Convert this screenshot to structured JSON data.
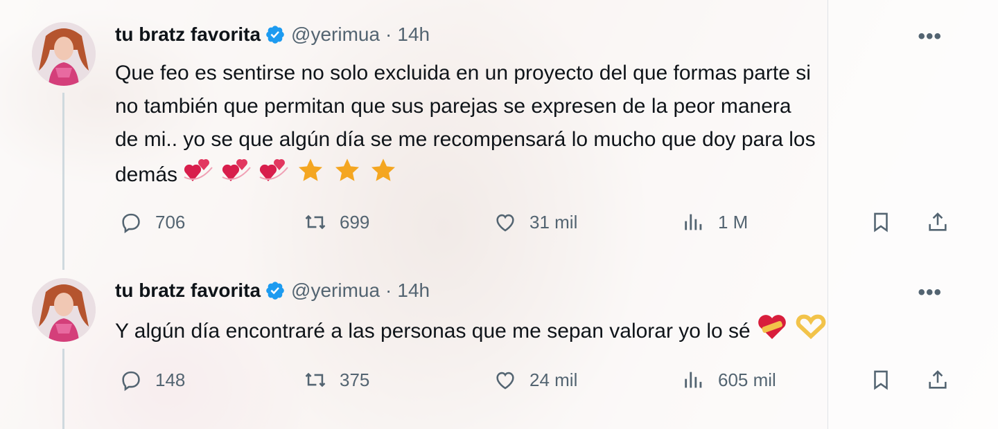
{
  "colors": {
    "accent": "#1d9bf0",
    "text": "#0f1419",
    "secondary": "#536471",
    "thread": "#cfd9de"
  },
  "tweets": [
    {
      "name": "tu bratz favorita",
      "handle": "@yerimua",
      "dot": "·",
      "time": "14h",
      "more": "•••",
      "text_lines": [
        "Que feo es sentirse no solo excluida en un proyecto del que formas parte si",
        "no también que permitan que sus parejas se expresen de la peor manera",
        "de mi.. yo se que algún día se me recompensará lo mucho que doy para los",
        "demás"
      ],
      "emojis": [
        "revolving-hearts",
        "revolving-hearts",
        "revolving-hearts",
        "star",
        "star",
        "star"
      ],
      "replies": "706",
      "retweets": "699",
      "likes": "31 mil",
      "views": "1 M"
    },
    {
      "name": "tu bratz favorita",
      "handle": "@yerimua",
      "dot": "·",
      "time": "14h",
      "more": "•••",
      "text_lines": [
        "Y algún día encontraré a las personas que me sepan valorar yo lo sé"
      ],
      "emojis": [
        "heart-with-bandage",
        "heart-hands"
      ],
      "replies": "148",
      "retweets": "375",
      "likes": "24 mil",
      "views": "605 mil"
    }
  ]
}
